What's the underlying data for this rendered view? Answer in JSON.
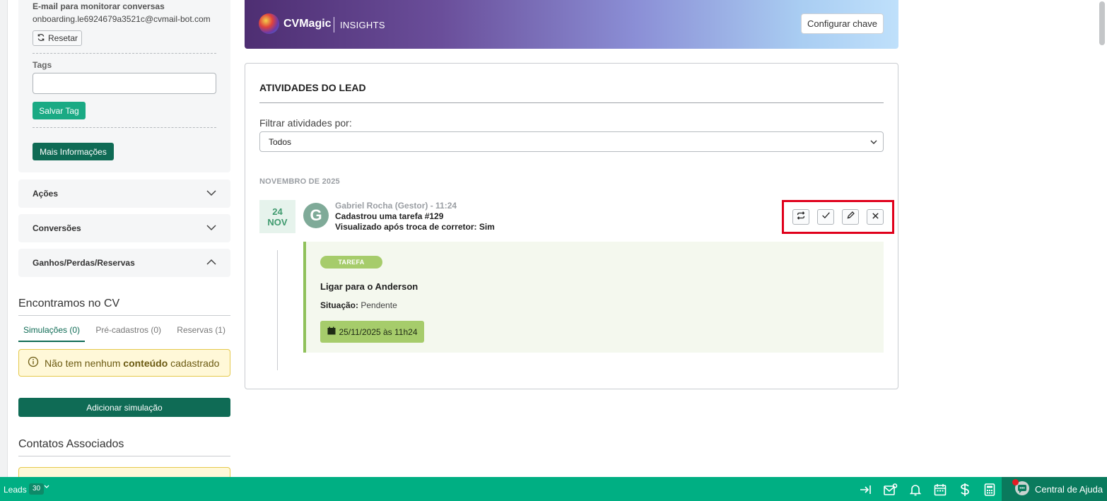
{
  "sidebar": {
    "email_label": "E-mail para monitorar conversas",
    "email_value": "onboarding.le6924679a3521c@cvmail-bot.com",
    "reset_label": "Resetar",
    "tags_label": "Tags",
    "tags_value": "",
    "save_tag_label": "Salvar Tag",
    "more_info_label": "Mais Informações",
    "accordions": [
      {
        "label": "Ações",
        "expanded": false
      },
      {
        "label": "Conversões",
        "expanded": false
      },
      {
        "label": "Ganhos/Perdas/Reservas",
        "expanded": true
      }
    ],
    "found_title": "Encontramos no CV",
    "tabs": [
      {
        "label": "Simulações (0)",
        "active": true
      },
      {
        "label": "Pré-cadastros (0)",
        "active": false
      },
      {
        "label": "Reservas (1)",
        "active": false
      }
    ],
    "empty_alert": {
      "prefix": "Não tem nenhum ",
      "bold": "conteúdo",
      "suffix": " cadastrado"
    },
    "add_simulation_label": "Adicionar simulação",
    "contacts_title": "Contatos Associados"
  },
  "banner": {
    "brand": "CVMagic",
    "sub": "INSIGHTS",
    "config_button": "Configurar chave"
  },
  "activities": {
    "title": "ATIVIDADES DO LEAD",
    "filter_label": "Filtrar atividades por:",
    "filter_value": "Todos",
    "month": "NOVEMBRO DE 2025",
    "item": {
      "day": "24",
      "month_short": "NOV",
      "avatar_letter": "G",
      "author": "Gabriel Rocha (Gestor) - 11:24",
      "line1": "Cadastrou uma tarefa #129",
      "line2": "Visualizado após troca de corretor:  Sim",
      "task": {
        "badge": "TAREFA",
        "title": "Ligar para o Anderson",
        "status_label": "Situação:",
        "status_value": "Pendente",
        "date": "25/11/2025 às 11h24"
      }
    }
  },
  "bottom_bar": {
    "leads_label": "Leads",
    "leads_count": "30",
    "help_label": "Central de Ajuda"
  },
  "colors": {
    "primary_green": "#00af83",
    "dark_green": "#0f6b55",
    "task_green": "#a6cc6b",
    "highlight_red": "#e0001b"
  }
}
